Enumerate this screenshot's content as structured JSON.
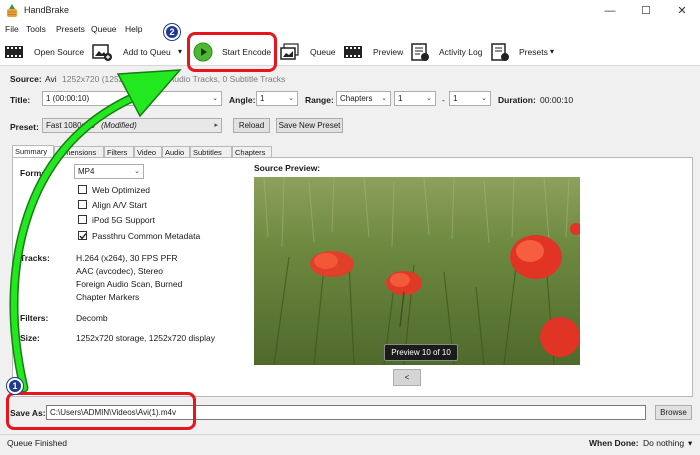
{
  "window": {
    "title": "HandBrake",
    "minimize_glyph": "—",
    "maximize_glyph": "☐",
    "close_glyph": "✕",
    "app_icon": "pineapple-icon"
  },
  "menu": {
    "items": [
      "File",
      "Tools",
      "Presets",
      "Queue",
      "Help"
    ]
  },
  "toolbar": {
    "open_source": "Open Source",
    "add_to_queue": "Add to Queu",
    "add_to_queue_dropdown": "▾",
    "start_encode": "Start Encode",
    "queue": "Queue",
    "preview": "Preview",
    "activity_log": "Activity Log",
    "presets": "Presets",
    "presets_dropdown": "▾"
  },
  "source": {
    "label": "Source:",
    "name": "Avi",
    "info": "1252x720 (1252x720)",
    "tracks_info": "1 Audio Tracks, 0 Subtitle Tracks"
  },
  "title_row": {
    "title_label": "Title:",
    "title_value": "1 (00:00:10)",
    "angle_label": "Angle:",
    "angle_value": "1",
    "range_label": "Range:",
    "range_type": "Chapters",
    "range_start": "1",
    "range_sep": "-",
    "range_end": "1",
    "duration_label": "Duration:",
    "duration_value": "00:00:10"
  },
  "preset_row": {
    "label": "Preset:",
    "value": "Fast 1080p30",
    "modified": "(Modified)",
    "reload": "Reload",
    "save_new": "Save New Preset"
  },
  "tabs": [
    "Summary",
    "Dimensions",
    "Filters",
    "Video",
    "Audio",
    "Subtitles",
    "Chapters"
  ],
  "summary": {
    "format_label": "Format:",
    "format_value": "MP4",
    "options": [
      {
        "label": "Web Optimized",
        "checked": false
      },
      {
        "label": "Align A/V Start",
        "checked": false
      },
      {
        "label": "iPod 5G Support",
        "checked": false
      },
      {
        "label": "Passthru Common Metadata",
        "checked": true
      }
    ],
    "tracks_label": "Tracks:",
    "tracks": [
      "H.264 (x264), 30 FPS PFR",
      "AAC (avcodec), Stereo",
      "Foreign Audio Scan, Burned",
      "Chapter Markers"
    ],
    "filters_label": "Filters:",
    "filters_value": "Decomb",
    "size_label": "Size:",
    "size_value": "1252x720 storage, 1252x720 display",
    "source_preview_label": "Source Preview:",
    "preview_badge": "Preview 10 of 10",
    "prev_button": "<"
  },
  "save": {
    "label": "Save As:",
    "path": "C:\\Users\\ADMIN\\Videos\\Avi(1).m4v",
    "browse": "Browse"
  },
  "status": {
    "text": "Queue Finished",
    "when_done_label": "When Done:",
    "when_done_value": "Do nothing",
    "when_done_dropdown": "▾"
  },
  "annotations": {
    "step1": "1",
    "step2": "2",
    "box_color": "#e8151e",
    "arrow_color": "#22e81f",
    "badge_color": "#1f3a8f"
  }
}
